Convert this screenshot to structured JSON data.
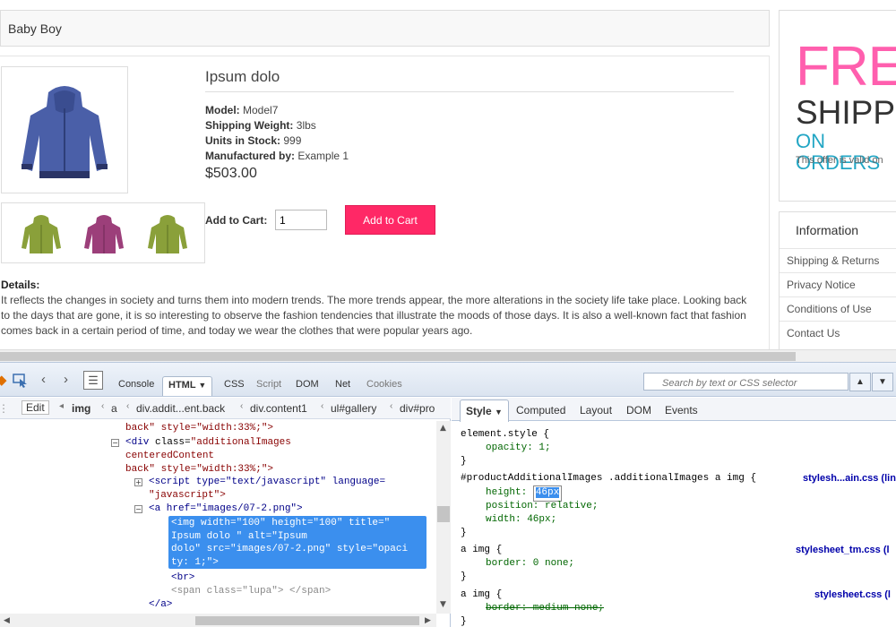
{
  "page": {
    "category_title": "Baby Boy",
    "product": {
      "title": "Ipsum dolo",
      "model_label": "Model:",
      "model_value": "Model7",
      "weight_label": "Shipping Weight:",
      "weight_value": "3lbs",
      "stock_label": "Units in Stock:",
      "stock_value": "999",
      "manuf_label": "Manufactured by:",
      "manuf_value": "Example 1",
      "price": "$503.00",
      "cart_label": "Add to Cart:",
      "qty_value": "1",
      "add_button": "Add to Cart",
      "details_heading": "Details:",
      "details_text": "It reflects the changes in society and turns them into modern trends. The more trends appear, the more alterations in the society life take place. Looking back to the days that are gone, it is so interesting to observe the fashion tendencies that illustrate the moods of those days. It is also a well-known fact that fashion comes back in a certain period of time, and today we wear the clothes that were popular years ago.",
      "main_image_color": "#4a5fa8",
      "thumb_colors": [
        "#8aa03a",
        "#9c3f7a",
        "#8aa03a"
      ]
    },
    "promo": {
      "free": "FREE",
      "shipping": "SHIPPING",
      "on_order": "ON ORDERS",
      "note": "This offer is valid on"
    },
    "info": {
      "title": "Information",
      "links": [
        "Shipping & Returns",
        "Privacy Notice",
        "Conditions of Use",
        "Contact Us"
      ]
    }
  },
  "firebug": {
    "tabs": [
      "Console",
      "HTML",
      "CSS",
      "Script",
      "DOM",
      "Net",
      "Cookies"
    ],
    "active_tab": "HTML",
    "search_placeholder": "Search by text or CSS selector",
    "edit_button": "Edit",
    "breadcrumbs": [
      "img",
      "a",
      "div.addit...ent.back",
      "div.content1",
      "ul#gallery",
      "div#pro"
    ],
    "tree": {
      "line1": "back\" style=\"width:33%;\">",
      "line2_tag": "<div ",
      "line2_attr": "class=",
      "line2_val": "\"additionalImages",
      "line3": "centeredContent",
      "line4": "back\" style=\"width:33%;\">",
      "line5": "<script type=\"text/javascript\" language=",
      "line6": "\"javascript\">",
      "line7": "<a href=\"images/07-2.png\">",
      "selected": "<img width=\"100\" height=\"100\" title=\"\nIpsum dolo \" alt=\"Ipsum\ndolo\" src=\"images/07-2.png\" style=\"opaci\nty: 1;\">",
      "line8": "<br>",
      "line9": "<span class=\"lupa\"> </span>",
      "line10": "</a>"
    },
    "side_tabs": [
      "Style",
      "Computed",
      "Layout",
      "DOM",
      "Events"
    ],
    "active_side_tab": "Style",
    "css": {
      "r1_sel": "element.style {",
      "r1_p1": "opacity: 1;",
      "r2_sel": "#productAdditionalImages .additionalImages a img {",
      "r2_src": "stylesh...ain.css (lin",
      "r2_p1_name": "height:",
      "r2_p1_val": "46px",
      "r2_p2": "position: relative;",
      "r2_p3": "width: 46px;",
      "r3_sel": "a img {",
      "r3_src": "stylesheet_tm.css (l",
      "r3_p1": "border: 0 none;",
      "r4_sel": "a img {",
      "r4_src": "stylesheet.css (l",
      "r4_p1": "border: medium none;",
      "close": "}"
    }
  }
}
